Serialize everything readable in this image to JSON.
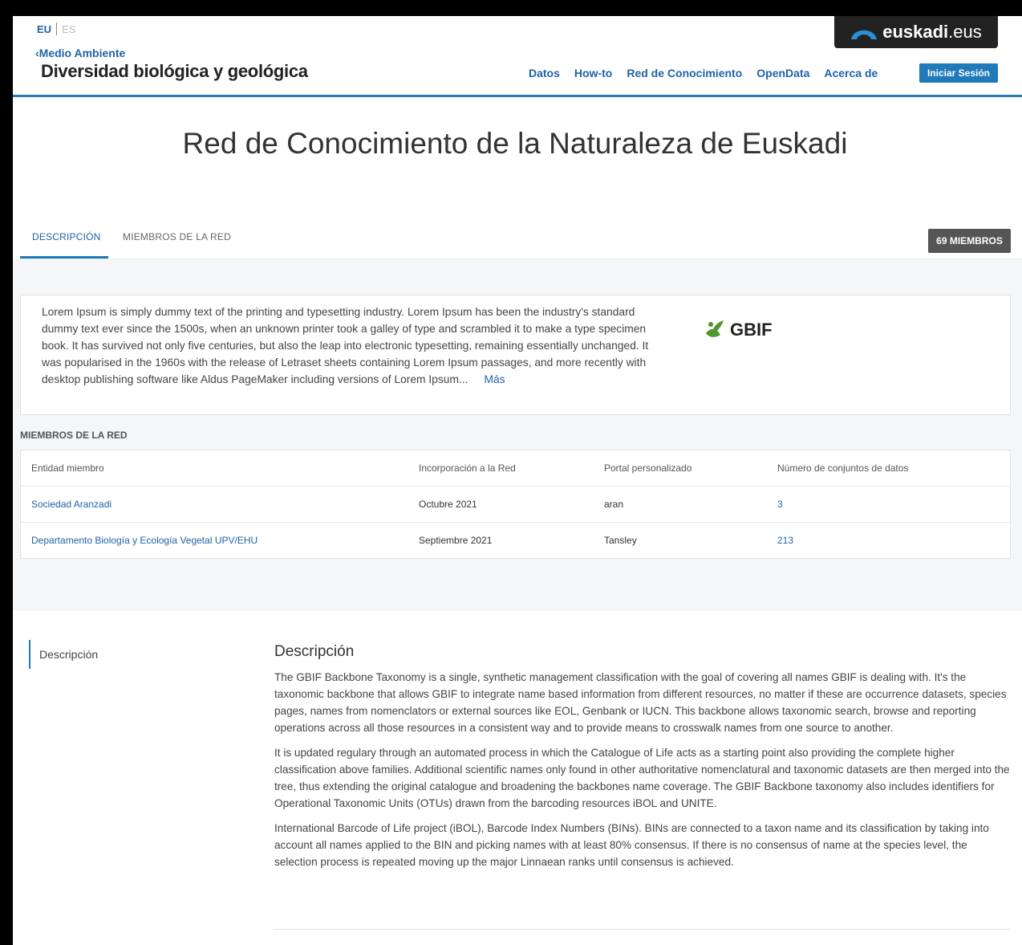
{
  "header": {
    "lang_active": "EU",
    "lang_inactive": "ES",
    "brand_bold": "euskadi",
    "brand_suffix": ".eus",
    "back_link": "Medio Ambiente",
    "back_icon": "chevron-left-icon",
    "site_title": "Diversidad biológica y geológica",
    "nav": [
      "Datos",
      "How-to",
      "Red de Conocimiento",
      "OpenData",
      "Acerca de"
    ],
    "login": "Iniciar Sesión"
  },
  "page_title": "Red de Conocimiento de la Naturaleza de Euskadi",
  "tabs": [
    "DESCRIPCIÓN",
    "MIEMBROS DE LA RED"
  ],
  "members_badge": "69 MIEMBROS",
  "description": {
    "text": "Lorem Ipsum is simply dummy text of the printing and typesetting industry. Lorem Ipsum has been the industry's standard dummy text ever since the 1500s, when an unknown printer took a galley of type and scrambled it to make a type specimen book. It has survived not only five centuries, but also the leap into electronic typesetting, remaining essentially unchanged. It was popularised in the 1960s with the release of Letraset sheets containing Lorem Ipsum passages, and more recently with desktop publishing software like Aldus PageMaker including versions of Lorem Ipsum...",
    "more": "Más",
    "logo_text": "GBIF"
  },
  "members": {
    "heading": "MIEMBROS DE LA RED",
    "columns": [
      "Entidad miembro",
      "Incorporación a la Red",
      "Portal personalizado",
      "Número de conjuntos de datos"
    ],
    "rows": [
      [
        "Sociedad Aranzadi",
        "Octubre 2021",
        "aran",
        "3"
      ],
      [
        "Departamento Biología y Ecología Vegetal UPV/EHU",
        "Septiembre 2021",
        "Tansley",
        "213"
      ]
    ]
  },
  "side_nav": "Descripción",
  "content": {
    "heading": "Descripción",
    "paragraphs": [
      "The GBIF Backbone Taxonomy is a single, synthetic management classification with the goal of covering all names GBIF is dealing with. It's the taxonomic backbone that allows GBIF to integrate name based information from different resources, no matter if these are occurrence datasets, species pages, names from nomenclators or external sources like EOL, Genbank or IUCN. This backbone allows taxonomic search, browse and reporting operations across all those resources in a consistent way and to provide means to crosswalk names from one source to another.",
      "It is updated regulary through an automated process in which the Catalogue of Life acts as a starting point also providing the complete higher classification above families. Additional scientific names only found in other authoritative nomenclatural and taxonomic datasets are then merged into the tree, thus extending the original catalogue and broadening the backbones name coverage. The GBIF Backbone taxonomy also includes identifiers for Operational Taxonomic Units (OTUs) drawn from the barcoding resources iBOL and UNITE.",
      "International Barcode of Life project (iBOL), Barcode Index Numbers (BINs). BINs are connected to a taxon name and its classification by taking into account all names applied to the BIN and picking names with at least 80% consensus. If there is no consensus of name at the species level, the selection process is repeated moving up the major Linnaean ranks until consensus is achieved."
    ]
  },
  "colors": {
    "accent": "#2079b8",
    "link": "#1f63a8",
    "badge": "#555555",
    "section_bg": "#f5f6f8"
  }
}
